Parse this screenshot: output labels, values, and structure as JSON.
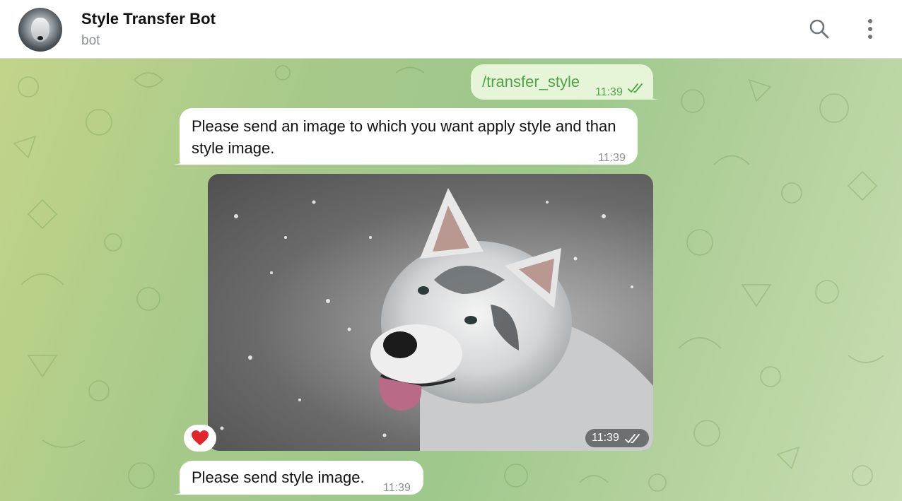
{
  "header": {
    "title": "Style Transfer Bot",
    "subtitle": "bot",
    "avatar_icon": "husky-avatar",
    "actions": [
      "search-icon",
      "more-vertical-icon"
    ]
  },
  "messages": [
    {
      "direction": "outgoing",
      "text": "/transfer_style",
      "time": "11:39",
      "status": "read"
    },
    {
      "direction": "incoming",
      "text": "Please send an image to which you want apply style and than style image.",
      "time": "11:39"
    },
    {
      "direction": "outgoing",
      "type": "photo",
      "subject": "husky dog in snow",
      "time": "11:39",
      "status": "read",
      "reaction": "❤️"
    },
    {
      "direction": "incoming",
      "text": "Please send style image.",
      "time": "11:39"
    }
  ],
  "colors": {
    "outgoing_bubble": "#e6f5d8",
    "outgoing_text": "#4ea34b",
    "incoming_bubble": "#ffffff",
    "reaction_heart": "#e0262b"
  }
}
